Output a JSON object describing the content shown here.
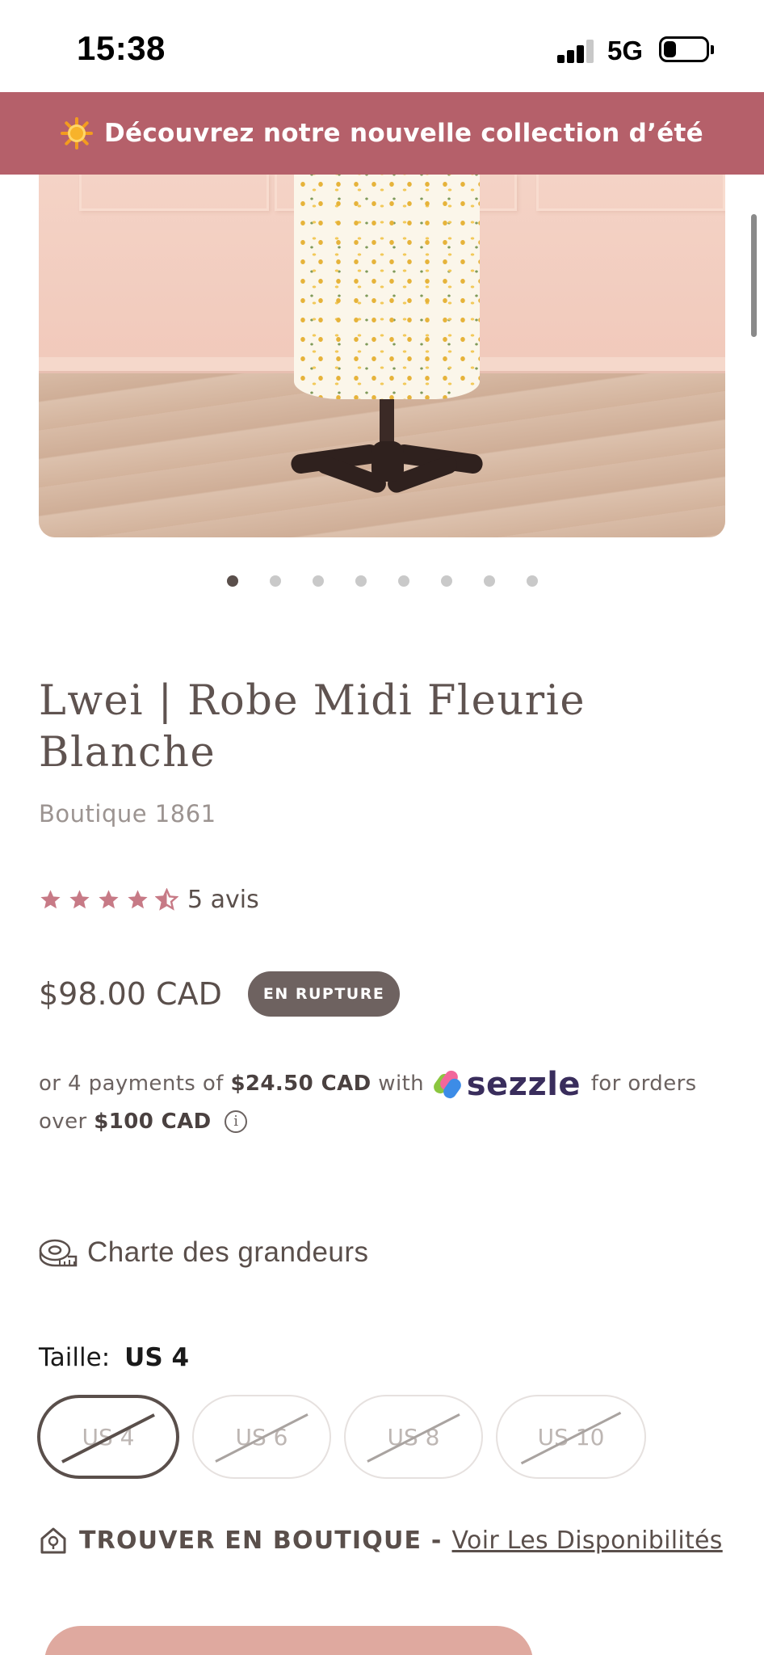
{
  "status_bar": {
    "time": "15:38",
    "network": "5G"
  },
  "banner": {
    "text": "Découvrez notre nouvelle collection d’été",
    "icon": "sun-icon",
    "background": "#b5606a"
  },
  "product": {
    "title": "Lwei | Robe Midi Fleurie Blanche",
    "vendor": "Boutique 1861",
    "rating": {
      "stars": 4.5,
      "max": 5,
      "count_label": "5 avis",
      "star_color": "#c77a86"
    },
    "price": "$98.00 CAD",
    "badge": "EN RUPTURE",
    "image_slides": 8,
    "active_slide": 1
  },
  "sezzle": {
    "prefix": "or 4 payments of",
    "installment": "$24.50 CAD",
    "with": "with",
    "brand": "sezzle",
    "suffix": "for orders over",
    "threshold": "$100 CAD"
  },
  "size_chart": {
    "label": "Charte des grandeurs",
    "icon": "tape-measure-icon"
  },
  "size_selector": {
    "label": "Taille:",
    "selected": "US 4",
    "options": [
      "US 4",
      "US 6",
      "US 8",
      "US 10"
    ]
  },
  "store_finder": {
    "label": "TROUVER EN BOUTIQUE -",
    "link": "Voir Les Disponibilités",
    "icon": "store-pin-icon"
  },
  "colors": {
    "accent": "#b5606a",
    "text": "#5a4f4b",
    "button": "#dfa99f"
  }
}
